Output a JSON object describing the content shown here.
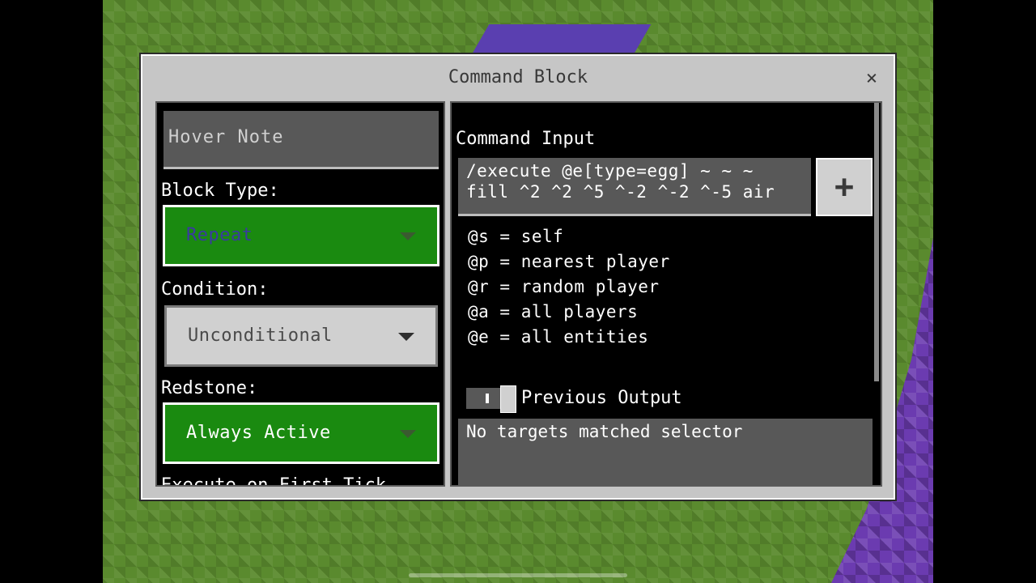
{
  "dialog": {
    "title": "Command Block",
    "close_label": "×"
  },
  "left": {
    "hover_note_placeholder": "Hover Note",
    "block_type_label": "Block Type:",
    "block_type_value": "Repeat",
    "condition_label": "Condition:",
    "condition_value": "Unconditional",
    "redstone_label": "Redstone:",
    "redstone_value": "Always Active",
    "execute_first_tick_label": "Execute on First Tick"
  },
  "right": {
    "command_input_label": "Command Input",
    "command_lines": [
      "/execute @e[type=egg] ~ ~ ~",
      "fill ^2 ^2 ^5 ^-2 ^-2 ^-5 air"
    ],
    "plus_label": "+",
    "selectors": [
      "@s = self",
      "@p = nearest player",
      "@r = random player",
      "@a = all players",
      "@e = all entities"
    ],
    "previous_output_label": "Previous Output",
    "previous_output_text": "No targets matched selector"
  },
  "colors": {
    "dialog_bg": "#c6c6c6",
    "panel_bg": "#000000",
    "green_dropdown": "#1a8a10",
    "input_bg": "#585858"
  }
}
